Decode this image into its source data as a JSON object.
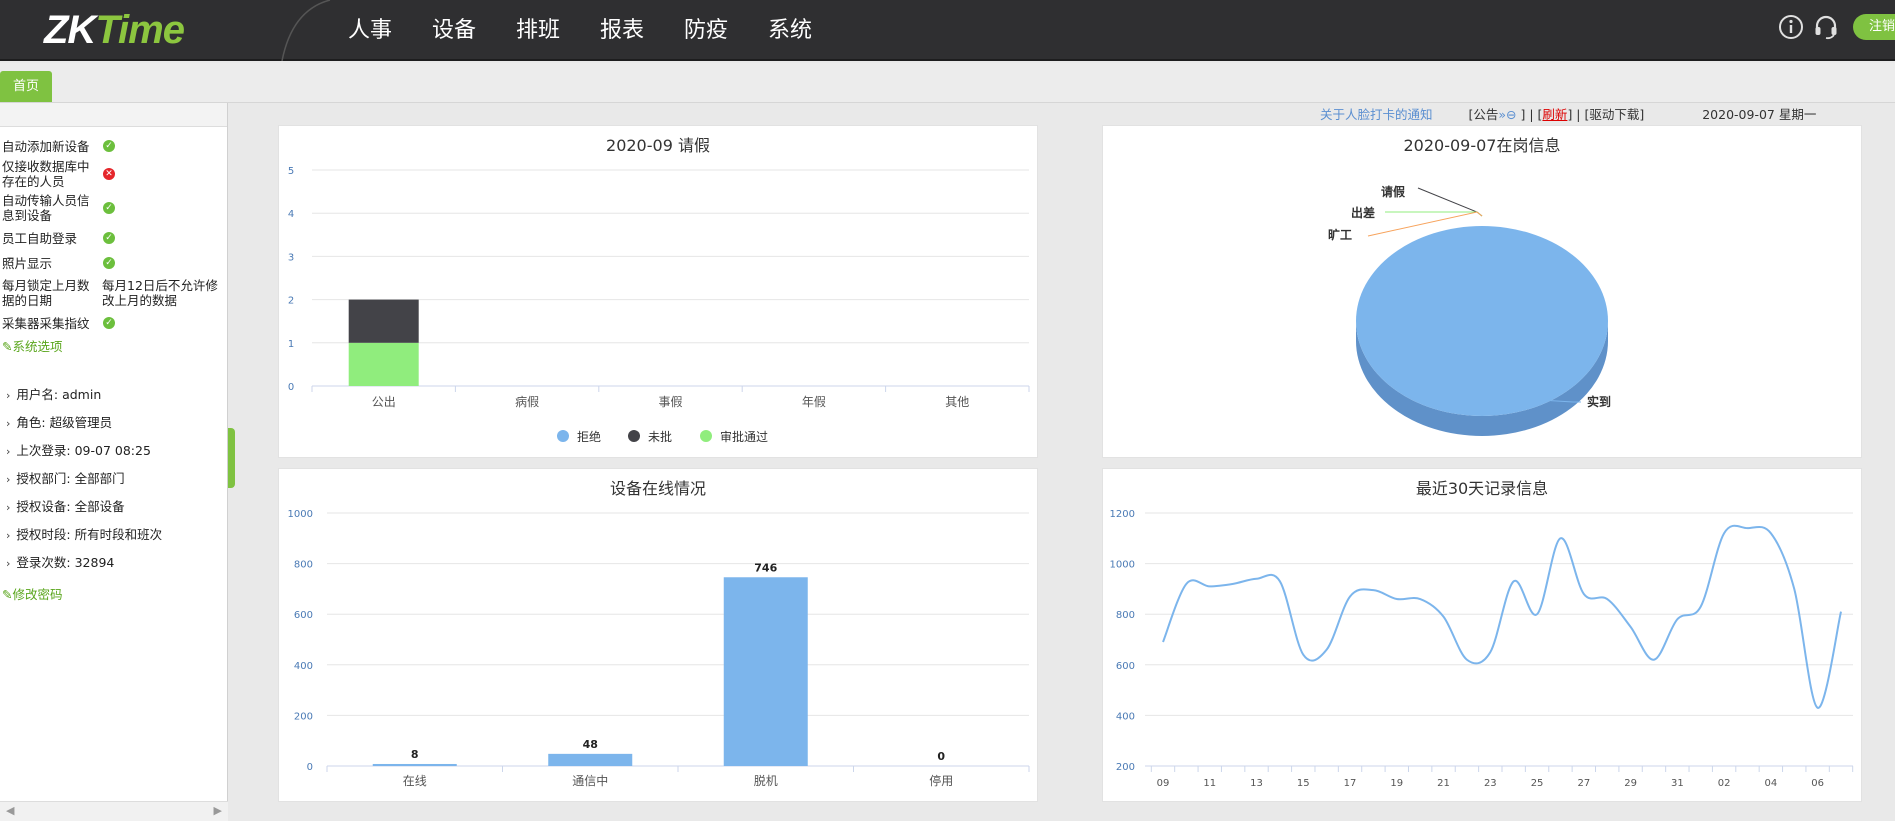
{
  "header": {
    "logo_prefix": "ZK",
    "logo_suffix": "Time",
    "nav": [
      "人事",
      "设备",
      "排班",
      "报表",
      "防疫",
      "系统"
    ],
    "logout_label": "注销"
  },
  "tabs": {
    "home": "首页"
  },
  "left_panel": {
    "options": [
      {
        "label": "自动添加新设备",
        "status": "ok"
      },
      {
        "label": "仅接收数据库中存在的人员",
        "status": "no"
      },
      {
        "label": "自动传输人员信息到设备",
        "status": "ok"
      },
      {
        "label": "员工自助登录",
        "status": "ok"
      },
      {
        "label": "照片显示",
        "status": "ok"
      },
      {
        "label": "每月锁定上月数据的日期",
        "value": "每月12日后不允许修改上月的数据"
      },
      {
        "label": "采集器采集指纹",
        "status": "ok"
      }
    ],
    "system_options_link": "系统选项",
    "user_info": [
      "用户名: admin",
      "角色: 超级管理员",
      "上次登录: 09-07 08:25",
      "授权部门: 全部部门",
      "授权设备: 全部设备",
      "授权时段: 所有时段和班次",
      "登录次数: 32894"
    ],
    "change_password_link": "修改密码"
  },
  "notice_bar": {
    "notice_link": "关于人脸打卡的通知",
    "announce": "公告",
    "refresh": "刷新",
    "driver_download": "驱动下载",
    "date": "2020-09-07",
    "weekday": "星期一"
  },
  "chart_data": [
    {
      "type": "bar",
      "stacked": true,
      "title": "2020-09 请假",
      "categories": [
        "公出",
        "病假",
        "事假",
        "年假",
        "其他"
      ],
      "series": [
        {
          "name": "拒绝",
          "values": [
            0,
            0,
            0,
            0,
            0
          ],
          "color": "#7cb5ec"
        },
        {
          "name": "未批",
          "values": [
            1,
            0,
            0,
            0,
            0
          ],
          "color": "#434348"
        },
        {
          "name": "审批通过",
          "values": [
            1,
            0,
            0,
            0,
            0
          ],
          "color": "#90ed7d"
        }
      ],
      "ylim": [
        0,
        5
      ],
      "yticks": [
        0,
        1,
        2,
        3,
        4,
        5
      ],
      "legend": "bottom"
    },
    {
      "type": "pie",
      "title": "2020-09-07在岗信息",
      "labels": [
        "实到",
        "请假",
        "出差",
        "旷工"
      ],
      "values": [
        100,
        0,
        0,
        0
      ],
      "colors": [
        "#7cb5ec",
        "#434348",
        "#90ed7d",
        "#f7a35c"
      ]
    },
    {
      "type": "bar",
      "title": "设备在线情况",
      "categories": [
        "在线",
        "通信中",
        "脱机",
        "停用"
      ],
      "values": [
        8,
        48,
        746,
        0
      ],
      "color": "#7cb5ec",
      "ylim": [
        0,
        1000
      ],
      "yticks": [
        0,
        200,
        400,
        600,
        800,
        1000
      ]
    },
    {
      "type": "line",
      "title": "最近30天记录信息",
      "x": [
        "08-09",
        "08-10",
        "08-11",
        "08-12",
        "08-13",
        "08-14",
        "08-15",
        "08-16",
        "08-17",
        "08-18",
        "08-19",
        "08-20",
        "08-21",
        "08-22",
        "08-23",
        "08-24",
        "08-25",
        "08-26",
        "08-27",
        "08-28",
        "08-29",
        "08-30",
        "08-31",
        "09-01",
        "09-02",
        "09-03",
        "09-04",
        "09-05",
        "09-06",
        "09-07"
      ],
      "values": [
        690,
        920,
        910,
        920,
        940,
        930,
        640,
        660,
        870,
        895,
        860,
        860,
        790,
        620,
        650,
        930,
        800,
        1100,
        880,
        860,
        750,
        620,
        780,
        830,
        1120,
        1140,
        1120,
        900,
        430,
        810
      ],
      "xticklabels": [
        "09",
        "11",
        "13",
        "15",
        "17",
        "19",
        "21",
        "23",
        "25",
        "27",
        "29",
        "31",
        "02",
        "04",
        "06"
      ],
      "ylim": [
        200,
        1200
      ],
      "yticks": [
        200,
        400,
        600,
        800,
        1000,
        1200
      ],
      "color": "#7cb5ec"
    }
  ]
}
